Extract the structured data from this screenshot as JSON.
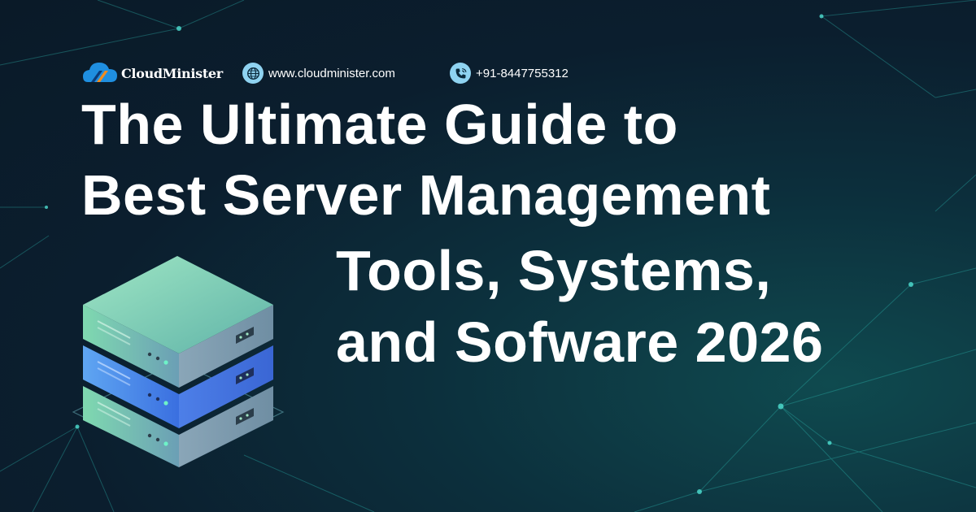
{
  "brand": {
    "name": "CloudMinister",
    "logo_icon": "cloud-logo-icon"
  },
  "contacts": [
    {
      "icon": "globe-icon",
      "text": "www.cloudminister.com"
    },
    {
      "icon": "phone-icon",
      "text": "+91-8447755312"
    }
  ],
  "headline": {
    "line1": "The Ultimate Guide to",
    "line2": "Best Server Management",
    "line3": "Tools, Systems,",
    "line4": "and Sofware 2026"
  },
  "illustration": {
    "icon": "server-stack-icon"
  },
  "colors": {
    "background": "#0b1e2e",
    "background_glow": "#0f4a4f",
    "network_lines": "#2fbfb6",
    "contact_icon_bg": "#8fd3f1",
    "logo_blue": "#1f8fe0",
    "logo_orange": "#f28c1e",
    "server_green": "#7fd9b0",
    "server_blue": "#3a7ef0",
    "text": "#ffffff"
  }
}
